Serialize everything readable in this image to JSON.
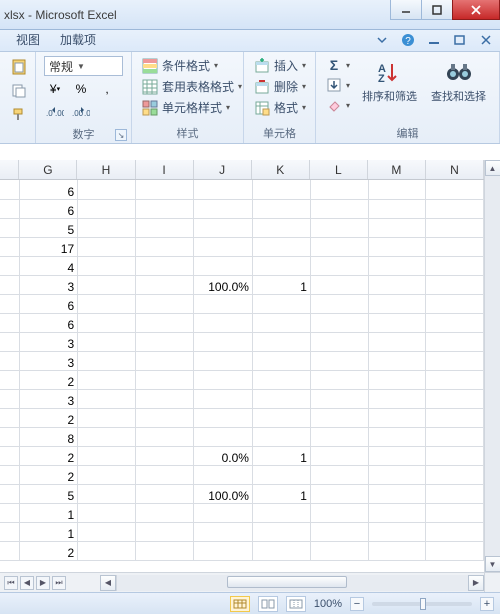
{
  "title": {
    "filename": "xlsx",
    "app": "Microsoft Excel",
    "sep": " - "
  },
  "tabs": {
    "view": "视图",
    "addins": "加载项"
  },
  "ribbon": {
    "number": {
      "format_combo": "常规",
      "group_label": "数字"
    },
    "styles": {
      "cond_fmt": "条件格式",
      "fmt_table": "套用表格格式",
      "cell_styles": "单元格样式",
      "group_label": "样式"
    },
    "cells": {
      "insert": "插入",
      "delete": "删除",
      "format": "格式",
      "group_label": "单元格"
    },
    "editing": {
      "sort_filter": "排序和筛选",
      "find_select": "查找和选择",
      "group_label": "编辑"
    }
  },
  "columns": [
    "G",
    "H",
    "I",
    "J",
    "K",
    "L",
    "M",
    "N"
  ],
  "grid": [
    {
      "G": "6"
    },
    {
      "G": "6"
    },
    {
      "G": "5"
    },
    {
      "G": "17"
    },
    {
      "G": "4"
    },
    {
      "G": "3",
      "J": "100.0%",
      "K": "1"
    },
    {
      "G": "6"
    },
    {
      "G": "6"
    },
    {
      "G": "3"
    },
    {
      "G": "3"
    },
    {
      "G": "2"
    },
    {
      "G": "3"
    },
    {
      "G": "2"
    },
    {
      "G": "8"
    },
    {
      "G": "2",
      "J": "0.0%",
      "K": "1"
    },
    {
      "G": "2"
    },
    {
      "G": "5",
      "J": "100.0%",
      "K": "1"
    },
    {
      "G": "1"
    },
    {
      "G": "1"
    },
    {
      "G": "2"
    }
  ],
  "status": {
    "zoom_pct": "100%"
  },
  "glyphs": {
    "percent": "%",
    "comma": ",",
    "currency": "¥",
    "sigma": "Σ",
    "dash": "–"
  }
}
